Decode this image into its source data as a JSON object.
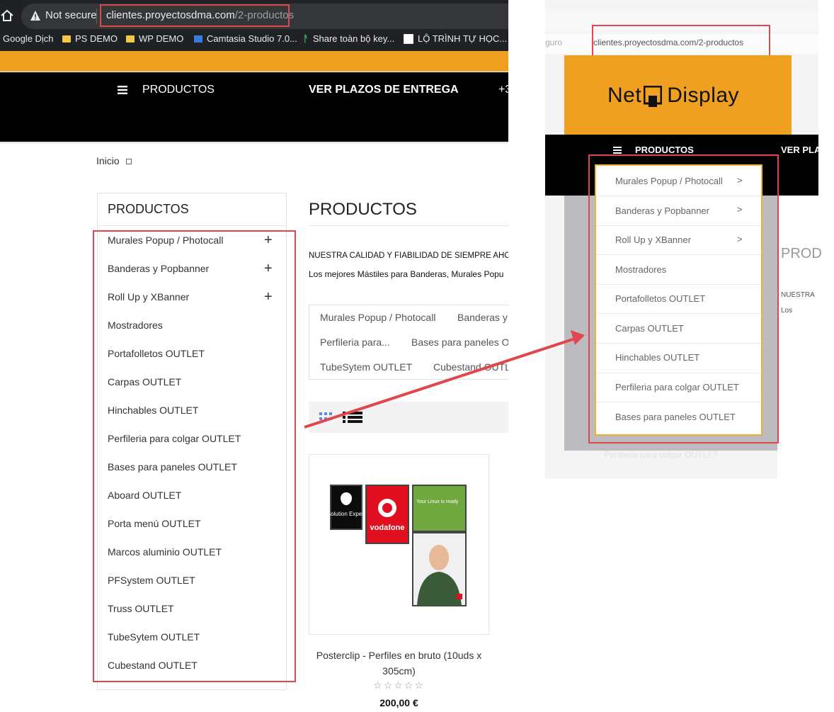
{
  "left_browser": {
    "not_secure": "Not secure",
    "url_host": "clientes.proyectosdma.com",
    "url_path": "/2-productos",
    "bookmarks": [
      "Google Dịch",
      "PS DEMO",
      "WP DEMO",
      "Camtasia Studio 7.0...",
      "Share toàn bộ key...",
      "LỘ TRÌNH TỰ HỌC..."
    ]
  },
  "site_nav": {
    "productos": "PRODUCTOS",
    "plazos": "VER PLAZOS DE ENTREGA",
    "phone_fragment": "+3"
  },
  "breadcrumb": {
    "home": "Inicio"
  },
  "sidebar": {
    "title": "PRODUCTOS",
    "items": [
      {
        "label": "Murales Popup / Photocall",
        "expand": "+"
      },
      {
        "label": "Banderas y Popbanner",
        "expand": "+"
      },
      {
        "label": "Roll Up y XBanner",
        "expand": "+"
      },
      {
        "label": "Mostradores"
      },
      {
        "label": "Portafolletos OUTLET"
      },
      {
        "label": "Carpas OUTLET"
      },
      {
        "label": "Hinchables OUTLET"
      },
      {
        "label": "Perfileria para colgar OUTLET"
      },
      {
        "label": "Bases para paneles OUTLET"
      },
      {
        "label": "Aboard OUTLET"
      },
      {
        "label": "Porta menú OUTLET"
      },
      {
        "label": "Marcos aluminio OUTLET"
      },
      {
        "label": "PFSystem OUTLET"
      },
      {
        "label": "Truss OUTLET"
      },
      {
        "label": "TubeSytem OUTLET"
      },
      {
        "label": "Cubestand OUTLET"
      }
    ]
  },
  "main": {
    "title": "PRODUCTOS",
    "line1": "NUESTRA CALIDAD Y FIABILIDAD DE SIEMPRE AHO",
    "line2": "Los mejores Mástiles para Banderas, Murales Popu",
    "subcategories": [
      "Murales Popup / Photocall",
      "Banderas y",
      "Perfileria para...",
      "Bases para paneles O",
      "TubeSytem OUTLET",
      "Cubestand OUTL"
    ],
    "product": {
      "name": "Posterclip - Perfiles en bruto (10uds x 305cm)",
      "stars": "☆☆☆☆☆",
      "price": "200,00 €",
      "poster_texts": [
        "Solution Expert",
        "vodafone",
        "Your Linux is ready"
      ]
    }
  },
  "right_screenshot": {
    "url_prefix": "guro",
    "url": "clientes.proyectosdma.com/2-productos",
    "logo_left": "Net",
    "logo_right": "Display",
    "nav_productos": "PRODUCTOS",
    "nav_fragment": "VER PLA",
    "page_title_fragment": "PROD",
    "nu_fragment": "NUESTRA",
    "los_fragment": "Los",
    "dropdown_items": [
      {
        "label": "Murales Popup / Photocall",
        "chevron": ">"
      },
      {
        "label": "Banderas y Popbanner",
        "chevron": ">"
      },
      {
        "label": "Roll Up y XBanner",
        "chevron": ">"
      },
      {
        "label": "Mostradores"
      },
      {
        "label": "Portafolletos OUTLET"
      },
      {
        "label": "Carpas OUTLET"
      },
      {
        "label": "Hinchables OUTLET"
      },
      {
        "label": "Perfileria para colgar OUTLET"
      },
      {
        "label": "Bases para paneles OUTLET"
      }
    ],
    "ghost_text": "Perfileria para colgar OUTLET"
  },
  "colors": {
    "accent_orange": "#f0a020",
    "highlight_red": "#e0474c",
    "dropdown_border": "#f0b030"
  }
}
